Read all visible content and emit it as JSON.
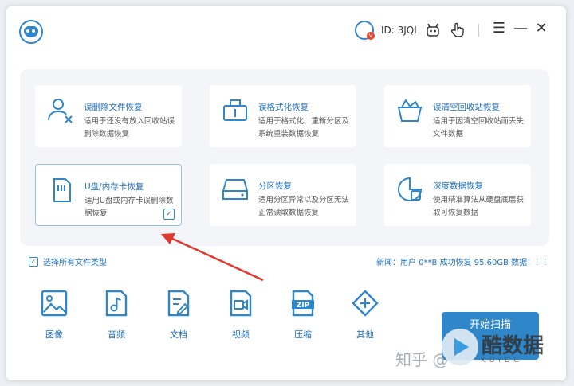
{
  "titlebar": {
    "user_id": "ID: 3JQI",
    "vip_badge": "V",
    "icons": [
      "robot-icon",
      "hand-pointer-icon"
    ],
    "menu_glyph": "☰",
    "minimize_glyph": "—",
    "close_glyph": "✕"
  },
  "cards": [
    {
      "title": "误删除文件恢复",
      "desc": "适用于还没有放入回收站误删除数据恢复",
      "icon": "user-delete-icon",
      "selected": false
    },
    {
      "title": "误格式化恢复",
      "desc": "适用于格式化、重新分区及系统重装数据恢复",
      "icon": "format-drive-icon",
      "selected": false
    },
    {
      "title": "误清空回收站恢复",
      "desc": "适用于因清空回收站而丢失文件数据",
      "icon": "recycle-bin-icon",
      "selected": false
    },
    {
      "title": "U盘/内存卡恢复",
      "desc": "适用U盘或内存卡误删除数据恢复",
      "icon": "sd-card-icon",
      "selected": true
    },
    {
      "title": "分区恢复",
      "desc": "适用分区异常以及分区无法正常读取数据恢复",
      "icon": "hard-disk-icon",
      "selected": false
    },
    {
      "title": "深度数据恢复",
      "desc": "使用精准算法从硬盘底层获取可恢复数据",
      "icon": "deep-scan-icon",
      "selected": false
    }
  ],
  "select_all": {
    "label": "选择所有文件类型",
    "checked": true
  },
  "news": "新闻：用户 0**B 成功恢复 95.60GB 数据！！！",
  "file_types": [
    {
      "label": "图像",
      "icon": "image-icon"
    },
    {
      "label": "音频",
      "icon": "music-icon"
    },
    {
      "label": "文档",
      "icon": "document-icon"
    },
    {
      "label": "视频",
      "icon": "video-icon"
    },
    {
      "label": "压缩",
      "icon": "zip-icon",
      "icon_text": "ZIP"
    },
    {
      "label": "其他",
      "icon": "plus-diamond-icon"
    }
  ],
  "start_button": "开始扫描",
  "watermark": {
    "zhihu": "知乎 @",
    "name": "酷数据",
    "sub": "K U I D C"
  },
  "colors": {
    "accent": "#2f86c9",
    "text_blue": "#1e6fb8",
    "arrow": "#e03a2f",
    "panel": "#f3f5f8"
  }
}
